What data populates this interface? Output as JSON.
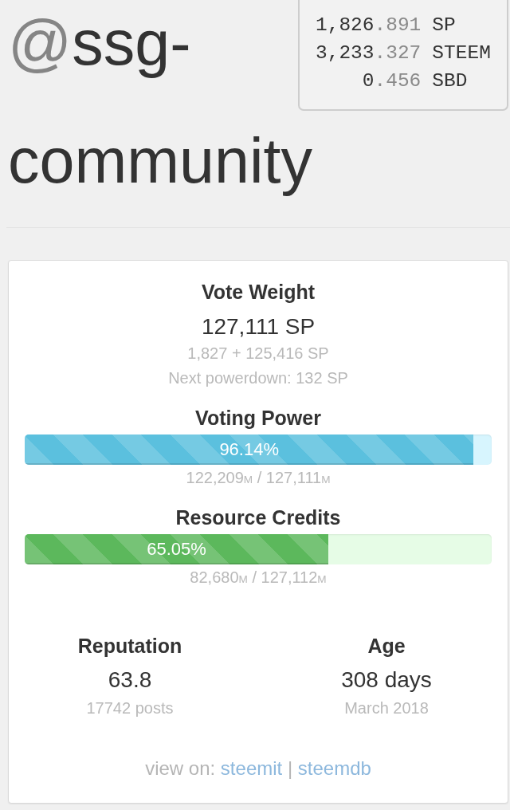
{
  "account": {
    "at_sign": "@",
    "name": "ssg-community"
  },
  "balances": [
    {
      "whole": "1,826",
      "fraction": ".891",
      "unit": "SP"
    },
    {
      "whole": "3,233",
      "fraction": ".327",
      "unit": "STEEM"
    },
    {
      "whole": "0",
      "fraction": ".456",
      "unit": "SBD"
    }
  ],
  "vote_weight": {
    "title": "Vote Weight",
    "value": "127,111 SP",
    "breakdown": "1,827 + 125,416 SP",
    "next_powerdown": "Next powerdown: 132 SP"
  },
  "meters": [
    {
      "kind": "voting",
      "title": "Voting Power",
      "level": 0.9614,
      "percent": "96.14%",
      "reading": "122,209$_{M}$ / 127,111$_{M}$"
    },
    {
      "kind": "resource",
      "title": "Resource Credits",
      "level": 0.6505,
      "percent": "65.05%",
      "reading": "82,680$_{M}$ / 127,112$_{M}$"
    }
  ],
  "stats": [
    {
      "title": "Reputation",
      "value": "63.8",
      "detail": "17742 posts"
    },
    {
      "title": "Age",
      "value": "308 days",
      "detail": "March 2018"
    }
  ],
  "view_on": {
    "label": "view on:",
    "links": [
      "steemit",
      "steemdb"
    ],
    "separator": "|"
  }
}
